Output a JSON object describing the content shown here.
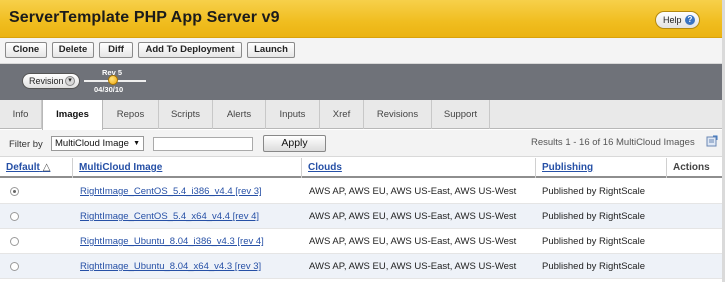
{
  "header": {
    "title": "ServerTemplate PHP App Server v9",
    "help_label": "Help",
    "help_icon": "question-mark-icon"
  },
  "toolbar": {
    "buttons": [
      "Clone",
      "Delete",
      "Diff",
      "Add To Deployment",
      "Launch"
    ]
  },
  "revision": {
    "selector_label": "Revision",
    "current": "Rev 5",
    "date": "04/30/10"
  },
  "tabs": [
    "Info",
    "Images",
    "Repos",
    "Scripts",
    "Alerts",
    "Inputs",
    "Xref",
    "Revisions",
    "Support"
  ],
  "active_tab": "Images",
  "filter": {
    "label": "Filter by",
    "selected": "MultiCloud Image",
    "query": "",
    "apply_label": "Apply",
    "results": "Results 1 - 16 of 16 MultiCloud Images"
  },
  "table": {
    "columns": [
      "Default",
      "MultiCloud Image",
      "Clouds",
      "Publishing",
      "Actions"
    ],
    "sort_indicator": "△",
    "rows": [
      {
        "default": true,
        "image": "RightImage_CentOS_5.4_i386_v4.4 [rev 3]",
        "clouds": "AWS AP, AWS EU, AWS US-East, AWS US-West",
        "publishing": "Published by RightScale"
      },
      {
        "default": false,
        "image": "RightImage_CentOS_5.4_x64_v4.4 [rev 4]",
        "clouds": "AWS AP, AWS EU, AWS US-East, AWS US-West",
        "publishing": "Published by RightScale"
      },
      {
        "default": false,
        "image": "RightImage_Ubuntu_8.04_i386_v4.3 [rev 4]",
        "clouds": "AWS AP, AWS EU, AWS US-East, AWS US-West",
        "publishing": "Published by RightScale"
      },
      {
        "default": false,
        "image": "RightImage_Ubuntu_8.04_x64_v4.3 [rev 3]",
        "clouds": "AWS AP, AWS EU, AWS US-East, AWS US-West",
        "publishing": "Published by RightScale"
      }
    ]
  },
  "colors": {
    "header_yellow": "#f0bd1f",
    "link_blue": "#2650a6",
    "revision_band": "#6f7279",
    "alt_row": "#eef2f8"
  }
}
